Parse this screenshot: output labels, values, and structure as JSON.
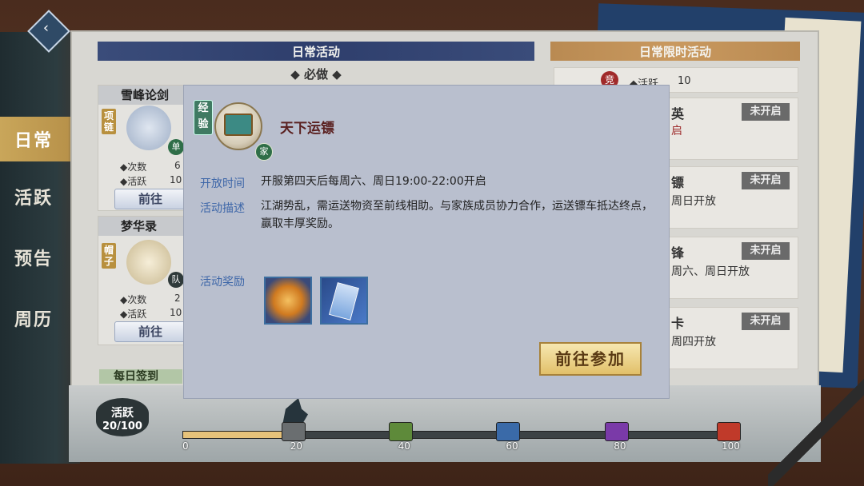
{
  "nav": {
    "back_icon": "back-icon",
    "items": [
      "日常",
      "活跃",
      "预告",
      "周历"
    ],
    "active": 0
  },
  "daily": {
    "banner": "日常活动",
    "section": "必做",
    "cards": [
      {
        "title": "雪峰论剑",
        "tag": "项链",
        "badge": "单",
        "stat1": "◆次数",
        "stat1_val": "6",
        "stat2": "◆活跃",
        "stat2_val": "10",
        "button": "前往"
      },
      {
        "title": "梦华录",
        "tag": "帽子",
        "badge": "队",
        "stat1": "◆次数",
        "stat1_val": "2",
        "stat2": "◆活跃",
        "stat2_val": "10",
        "button": "前往"
      }
    ],
    "partial_next_title": "每日签到"
  },
  "limited": {
    "banner": "日常限时活动",
    "top_badge": "竞",
    "top_stat": "◆活跃",
    "top_stat_val": "10",
    "cards": [
      {
        "title": "英",
        "sub": "启",
        "status": "未开启"
      },
      {
        "title": "镖",
        "sub": "周日开放",
        "status": "未开启"
      },
      {
        "title": "锋",
        "sub": "周六、周日开放",
        "status": "未开启"
      },
      {
        "title": "卡",
        "sub": "周四开放",
        "status": "未开启"
      }
    ]
  },
  "dialog": {
    "exp_badge": "经验",
    "family_badge": "家",
    "title": "天下运镖",
    "open_time_label": "开放时间",
    "open_time": "开服第四天后每周六、周日19:00-22:00开启",
    "desc_label": "活动描述",
    "desc": "江湖势乱，需运送物资至前线相助。与家族成员协力合作，运送镖车抵达终点，赢取丰厚奖励。",
    "reward_label": "活动奖励",
    "rewards": [
      "golden-orb-icon",
      "ticket-icon"
    ],
    "join_button": "前往参加"
  },
  "progress": {
    "label": "活跃",
    "value": "20/100",
    "current": 20,
    "max": 100,
    "ticks": [
      "0",
      "20",
      "40",
      "60",
      "80",
      "100"
    ],
    "colors": {
      "fill": "#e6c27a",
      "track": "#3c4244"
    }
  }
}
